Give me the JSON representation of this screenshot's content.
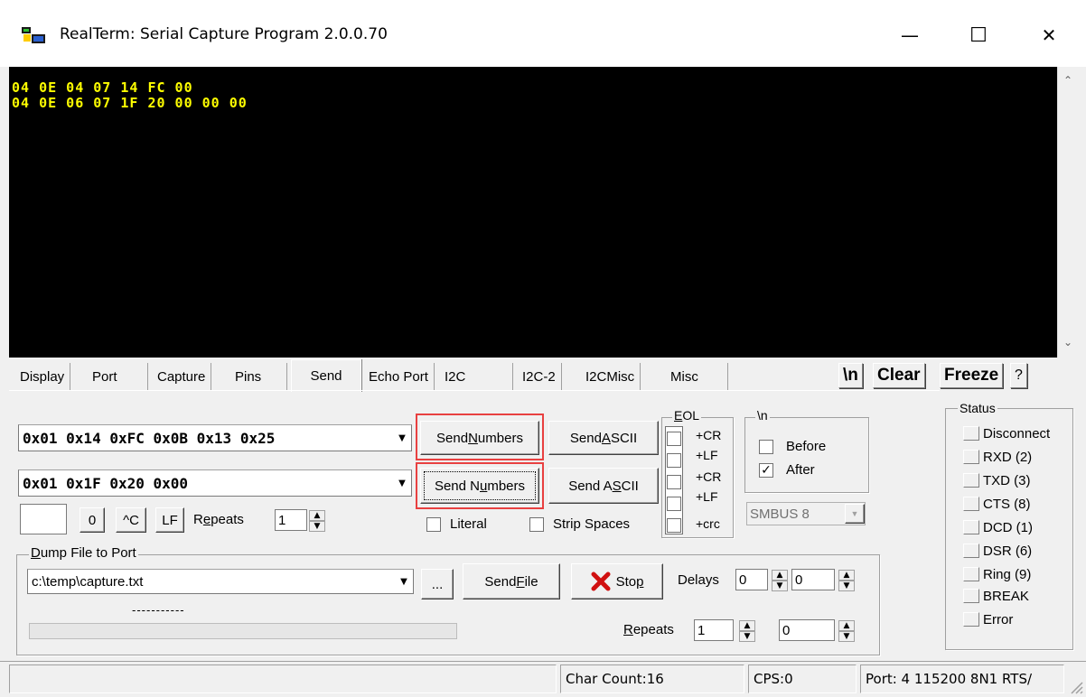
{
  "window": {
    "title": "RealTerm: Serial Capture Program 2.0.0.70",
    "minimize_glyph": "—",
    "maximize_glyph": "☐",
    "close_glyph": "✕"
  },
  "terminal": {
    "lines": [
      "04 0E 04 07 14 FC 00",
      "04 0E 06 07 1F 20 00 00 00"
    ],
    "text_color": "#ffff00",
    "background": "#000000"
  },
  "tabs": [
    {
      "label": "Display",
      "active": false
    },
    {
      "label": "Port",
      "active": false
    },
    {
      "label": "Capture",
      "active": false
    },
    {
      "label": "Pins",
      "active": false
    },
    {
      "label": "Send",
      "active": true
    },
    {
      "label": "Echo Port",
      "active": false
    },
    {
      "label": "I2C",
      "active": false
    },
    {
      "label": "I2C-2",
      "active": false
    },
    {
      "label": "I2CMisc",
      "active": false
    },
    {
      "label": "Misc",
      "active": false
    }
  ],
  "toolbar": {
    "newline_label": "\\n",
    "clear_label": "Clear",
    "freeze_label": "Freeze",
    "help_label": "?"
  },
  "send": {
    "line1_value": "0x01 0x14 0xFC 0x0B 0x13 0x25",
    "line2_value": "0x01 0x1F 0x20 0x00",
    "send_numbers_pre": "Send ",
    "send_numbers_ul": "N",
    "send_numbers_post": "umbers",
    "send_numbers2_pre": "Send N",
    "send_numbers2_ul": "u",
    "send_numbers2_post": "mbers",
    "send_ascii_pre": "Send ",
    "send_ascii_ul": "A",
    "send_ascii_post": "SCII",
    "send_ascii2_pre": "Send A",
    "send_ascii2_ul": "S",
    "send_ascii2_post": "CII",
    "zero_btn": "0",
    "ctrl_c_btn": "^C",
    "lf_btn": "LF",
    "repeats_pre": "R",
    "repeats_ul": "e",
    "repeats_post": "peats",
    "repeats_value": "1",
    "literal_label": "Literal",
    "strip_spaces_label": "Strip Spaces",
    "highlight_color": "#e84040"
  },
  "eol": {
    "group_label": "EOL",
    "group_label_ul": "E",
    "group_label_rest": "OL",
    "cr1": "+CR",
    "lf1": "+LF",
    "cr2": "+CR",
    "lf2": "+LF",
    "crc": "+crc"
  },
  "newline_group": {
    "label": "\\n",
    "before_label": "Before",
    "before_checked": false,
    "after_label": "After",
    "after_checked": true,
    "smbus_value": "SMBUS 8"
  },
  "dump": {
    "group_ul": "D",
    "group_rest": "ump File to Port",
    "file_path": "c:\\temp\\capture.txt",
    "browse_label": "...",
    "send_file_pre": "Send ",
    "send_file_ul": "F",
    "send_file_post": "ile",
    "stop_pre": "Sto",
    "stop_ul": "p",
    "delays_label": "Delays",
    "delay1": "0",
    "delay2": "0",
    "progress_text": "-----------",
    "repeats_ul": "R",
    "repeats_post": "epeats",
    "repeats1": "1",
    "repeats2": "0"
  },
  "status": {
    "group_label": "Status",
    "items": [
      "Disconnect",
      "RXD (2)",
      "TXD (3)",
      "CTS (8)",
      "DCD (1)",
      "DSR (6)",
      "Ring (9)",
      "BREAK",
      "Error"
    ]
  },
  "statusbar": {
    "char_count": "Char Count:16",
    "cps": "CPS:0",
    "port": "Port: 4 115200 8N1 RTS/"
  }
}
